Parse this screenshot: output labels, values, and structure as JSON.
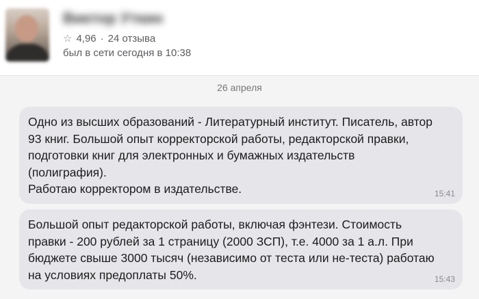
{
  "profile": {
    "name": "Виктор Уткин",
    "rating": "4,96",
    "separator": "·",
    "reviews": "24 отзыва",
    "last_seen": "был в сети сегодня в 10:38"
  },
  "chat": {
    "date_divider": "26 апреля",
    "messages": [
      {
        "text": "Одно из высших образований - Литературный институт. Писатель, автор 93 книг. Большой опыт корректорской работы, редакторской правки, подготовки книг для электронных и бумажных издательств (полиграфия).\nРаботаю корректором в издательстве.",
        "time": "15:41"
      },
      {
        "text": "Большой опыт редакторской работы, включая фэнтези. Стоимость правки - 200 рублей за 1 страницу (2000 ЗСП), т.е.  4000 за 1 а.л. При бюджете свыше 3000 тысяч (независимо от теста или не-теста) работаю на условиях предоплаты 50%.",
        "time": "15:43"
      }
    ]
  }
}
